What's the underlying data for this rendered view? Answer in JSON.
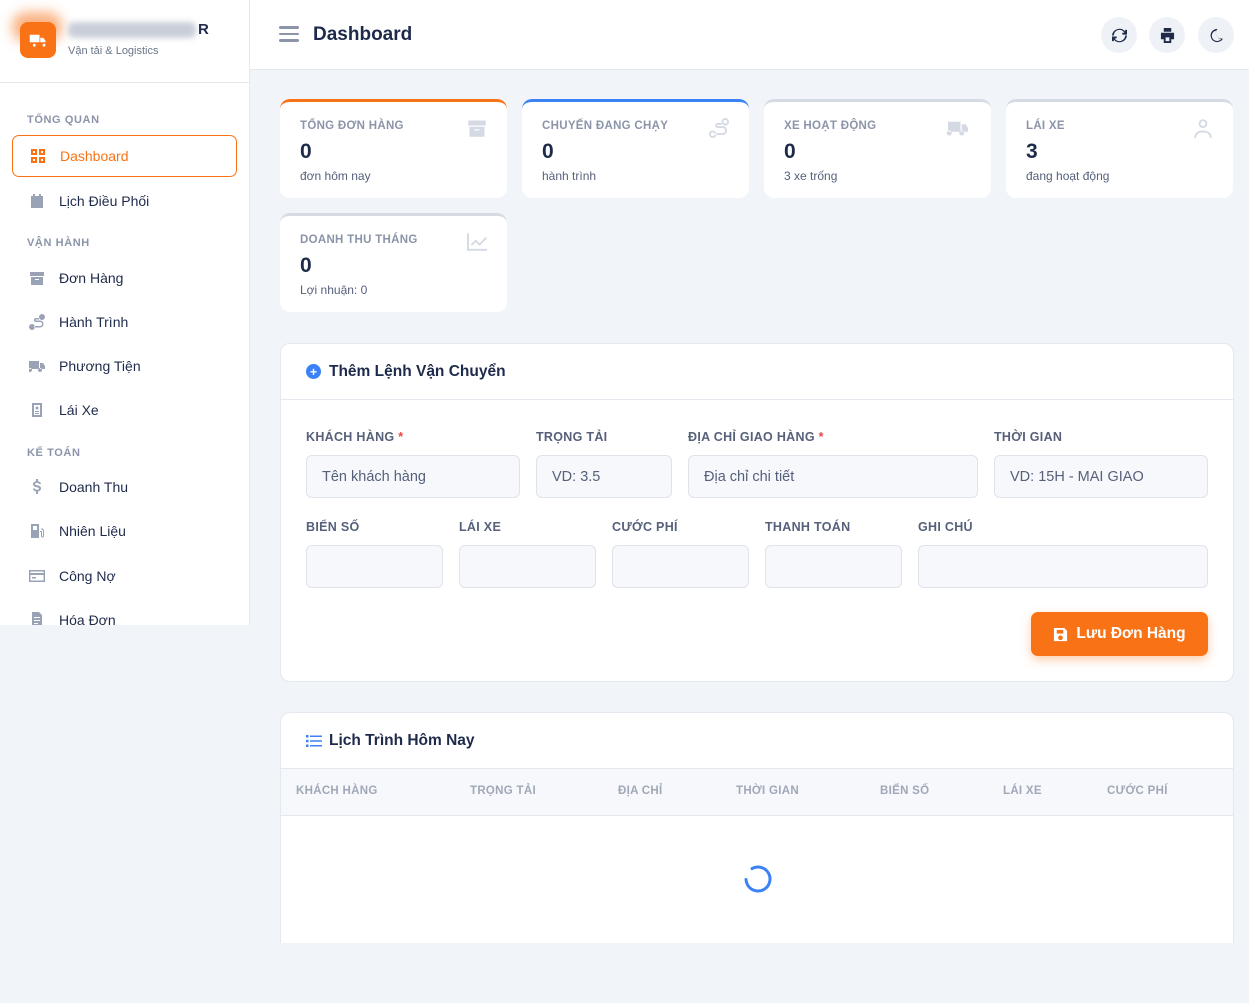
{
  "brand": {
    "name_suffix": "R",
    "subtitle": "Vận tải & Logistics"
  },
  "sidebar": {
    "sections": [
      "TỔNG QUAN",
      "VẬN HÀNH",
      "KẾ TOÁN"
    ],
    "items": [
      {
        "label": "Dashboard",
        "icon": "grid-icon"
      },
      {
        "label": "Lịch Điều Phối",
        "icon": "calendar-icon"
      },
      {
        "label": "Đơn Hàng",
        "icon": "box-icon"
      },
      {
        "label": "Hành Trình",
        "icon": "route-icon"
      },
      {
        "label": "Phương Tiện",
        "icon": "truck-icon"
      },
      {
        "label": "Lái Xe",
        "icon": "id-badge-icon"
      },
      {
        "label": "Doanh Thu",
        "icon": "dollar-icon"
      },
      {
        "label": "Nhiên Liệu",
        "icon": "fuel-icon"
      },
      {
        "label": "Công Nợ",
        "icon": "credit-card-icon"
      },
      {
        "label": "Hóa Đơn",
        "icon": "invoice-icon"
      }
    ]
  },
  "header": {
    "title": "Dashboard"
  },
  "stats": [
    {
      "label": "TỔNG ĐƠN HÀNG",
      "value": "0",
      "sub": "đơn hôm nay",
      "accent": "#f97316",
      "icon": "box-icon"
    },
    {
      "label": "CHUYẾN ĐANG CHẠY",
      "value": "0",
      "sub": "hành trình",
      "accent": "#3b82f6",
      "icon": "route-icon"
    },
    {
      "label": "XE HOẠT ĐỘNG",
      "value": "0",
      "sub": "3 xe trống",
      "accent": "#d6dae3",
      "icon": "truck-icon"
    },
    {
      "label": "LÁI XE",
      "value": "3",
      "sub": "đang hoạt động",
      "accent": "#d6dae3",
      "icon": "user-icon"
    },
    {
      "label": "DOANH THU THÁNG",
      "value": "0",
      "sub": "Lợi nhuận: 0",
      "accent": "#d6dae3",
      "icon": "chart-line-icon"
    }
  ],
  "form": {
    "title": "Thêm Lệnh Vận Chuyển",
    "fields": [
      {
        "label": "KHÁCH HÀNG",
        "required": true,
        "placeholder": "Tên khách hàng"
      },
      {
        "label": "TRỌNG TẢI",
        "required": false,
        "placeholder": "VD: 3.5"
      },
      {
        "label": "ĐỊA CHỈ GIAO HÀNG",
        "required": true,
        "placeholder": "Địa chỉ chi tiết"
      },
      {
        "label": "THỜI GIAN",
        "required": false,
        "placeholder": "VD: 15H - MAI GIAO"
      },
      {
        "label": "BIỂN SỐ",
        "required": false,
        "placeholder": ""
      },
      {
        "label": "LÁI XE",
        "required": false,
        "placeholder": ""
      },
      {
        "label": "CƯỚC PHÍ",
        "required": false,
        "placeholder": ""
      },
      {
        "label": "THANH TOÁN",
        "required": false,
        "placeholder": ""
      },
      {
        "label": "GHI CHÚ",
        "required": false,
        "placeholder": ""
      }
    ],
    "required_mark": "*",
    "save_label": "Lưu Đơn Hàng"
  },
  "schedule": {
    "title": "Lịch Trình Hôm Nay",
    "columns": [
      "KHÁCH HÀNG",
      "TRỌNG TẢI",
      "ĐỊA CHỈ",
      "THỜI GIAN",
      "BIỂN SỐ",
      "LÁI XE",
      "CƯỚC PHÍ"
    ],
    "loading_color": "#3b82f6"
  }
}
